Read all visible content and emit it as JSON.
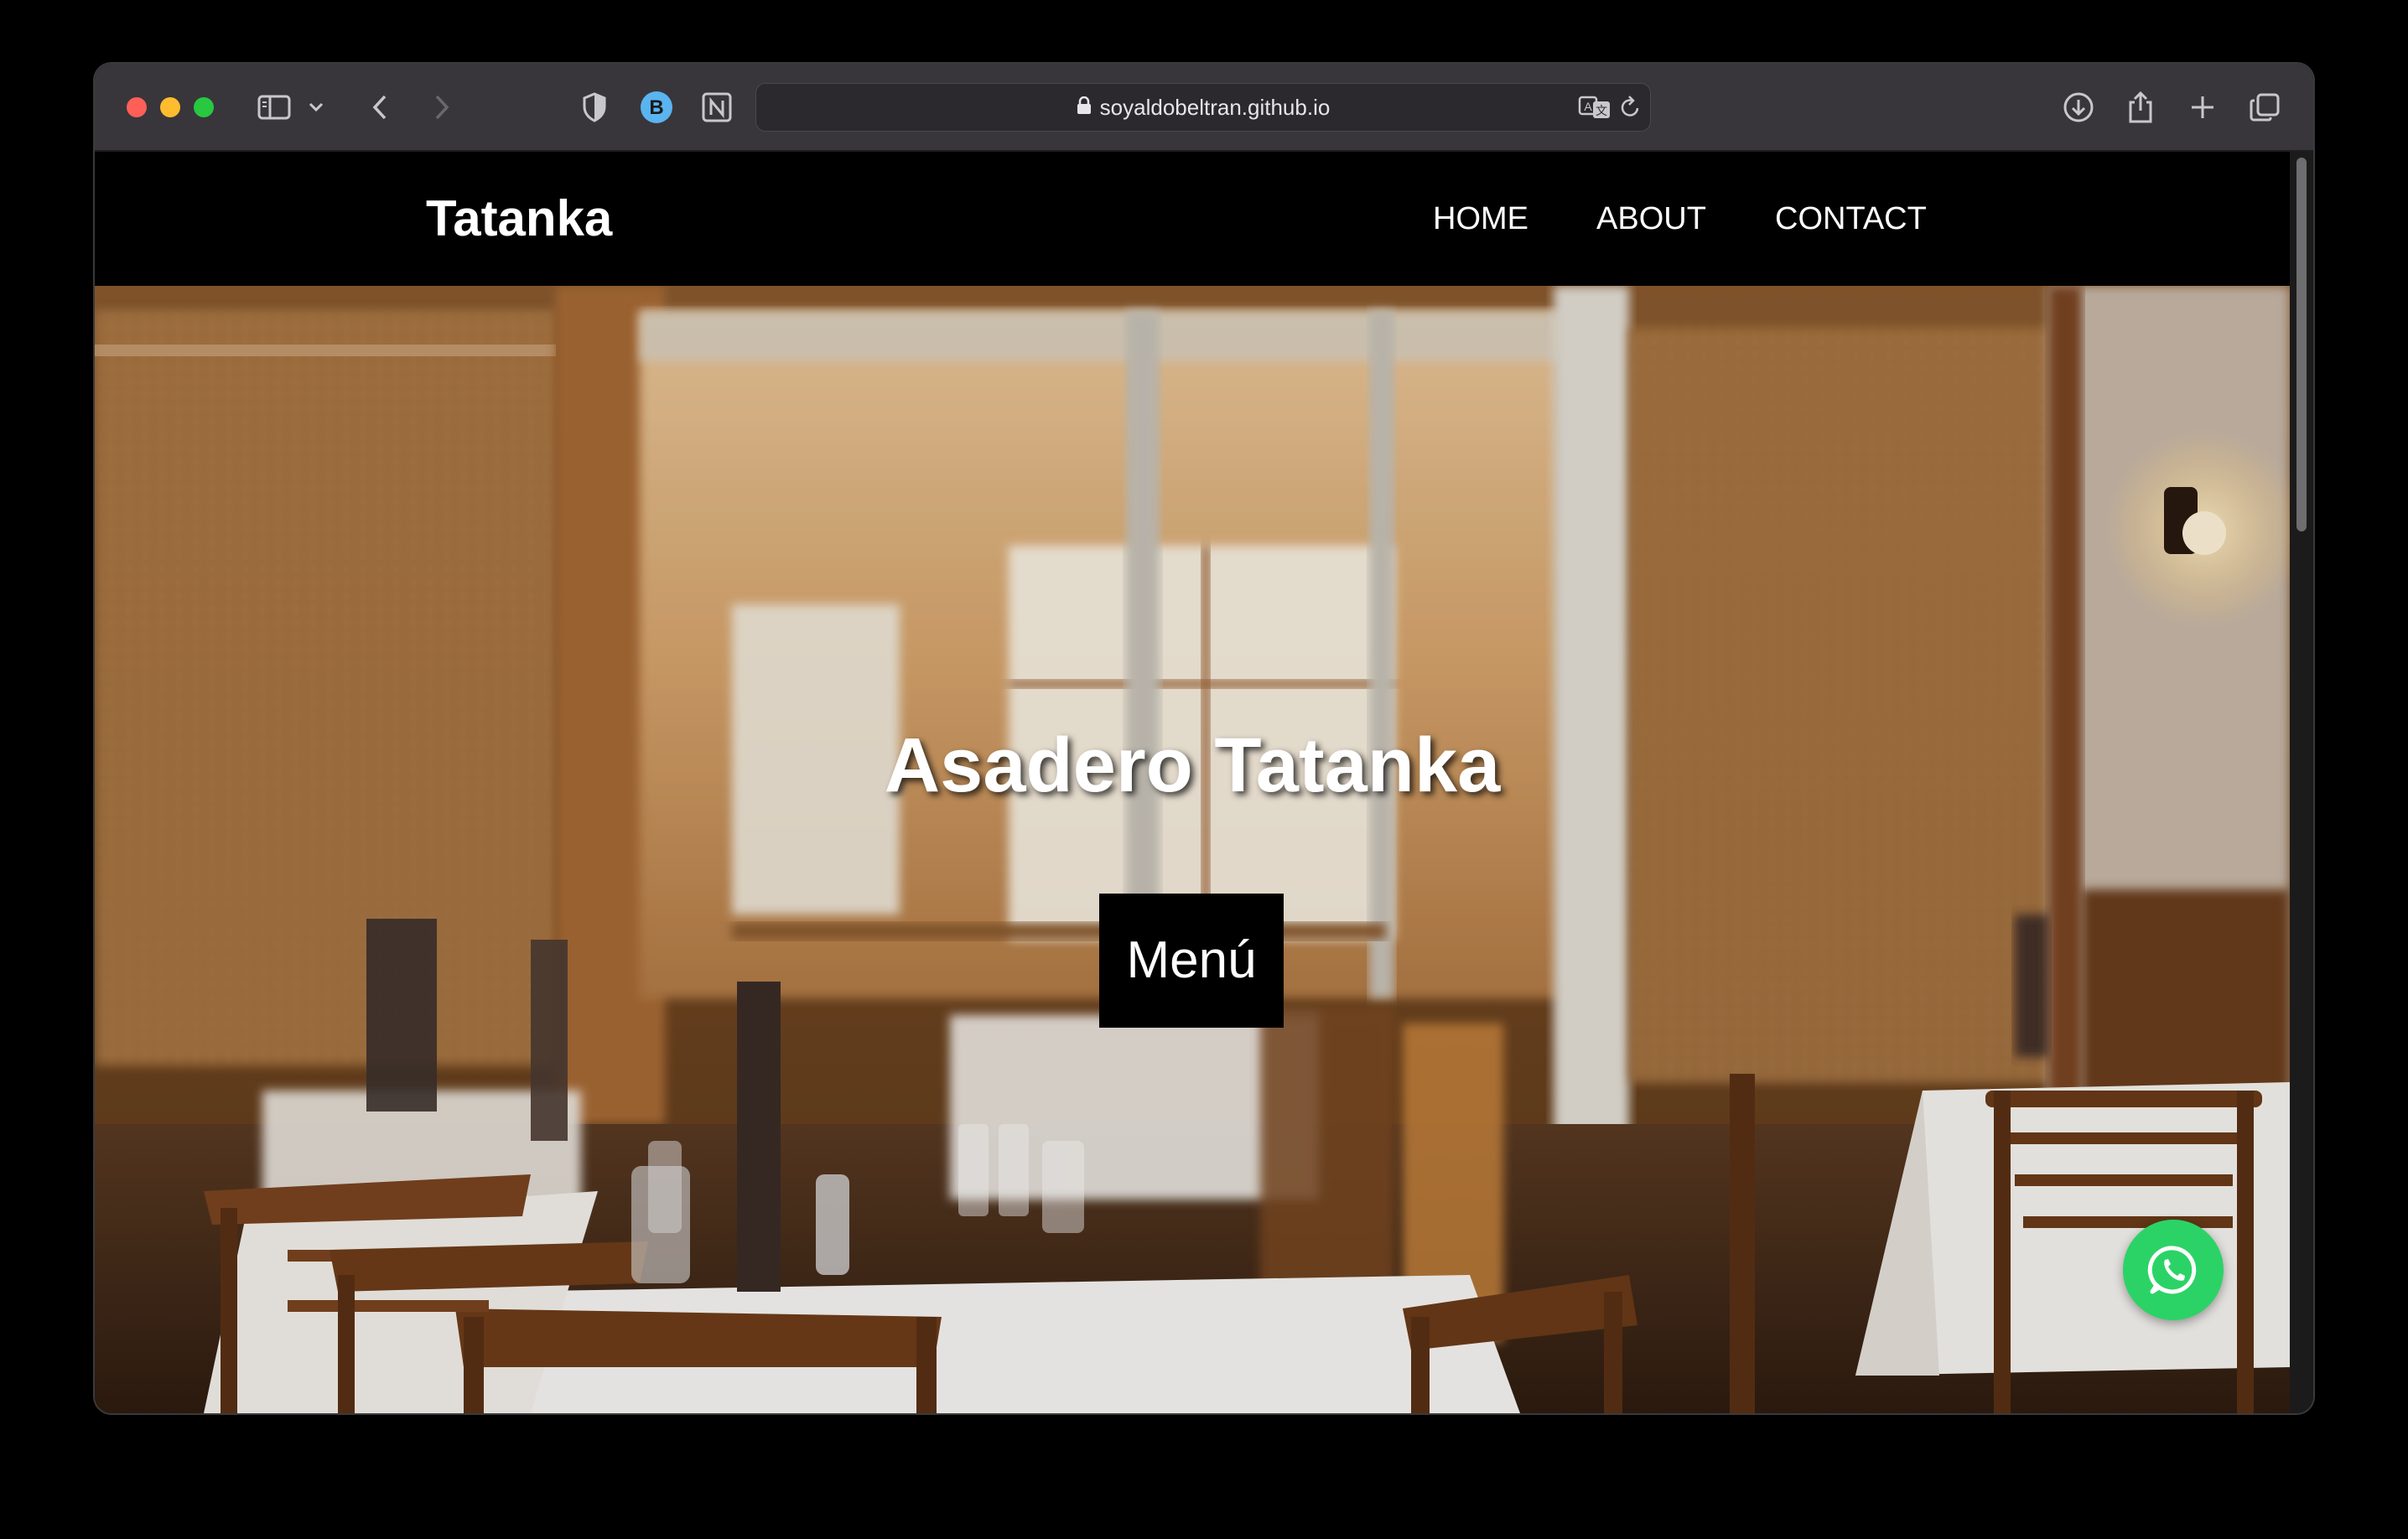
{
  "browser": {
    "url": "soyaldobeltran.github.io",
    "icons": [
      "sidebar-icon",
      "chevron-down-icon",
      "back-icon",
      "forward-icon",
      "shield-icon",
      "bitwarden-icon",
      "notion-icon",
      "lock-icon",
      "translate-icon",
      "reload-icon",
      "download-icon",
      "share-icon",
      "new-tab-icon",
      "tabs-overview-icon"
    ],
    "extension_b_label": "B"
  },
  "site": {
    "brand": "Tatanka",
    "nav": [
      "HOME",
      "ABOUT",
      "CONTACT"
    ],
    "hero": {
      "title": "Asadero Tatanka",
      "button_label": "Menú"
    },
    "floating_button_icon": "whatsapp-icon",
    "colors": {
      "nav_background": "#000000",
      "whatsapp_green": "#2bd366",
      "button_background": "#000000"
    }
  }
}
